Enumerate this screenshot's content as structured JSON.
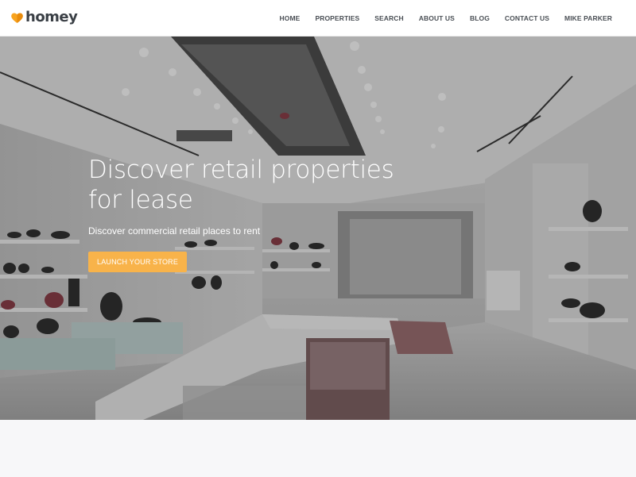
{
  "brand": {
    "name": "homey",
    "accent_color": "#f8a31e"
  },
  "nav": {
    "items": [
      {
        "label": "HOME"
      },
      {
        "label": "PROPERTIES"
      },
      {
        "label": "SEARCH"
      },
      {
        "label": "ABOUT US"
      },
      {
        "label": "BLOG"
      },
      {
        "label": "CONTACT US"
      },
      {
        "label": "MIKE PARKER"
      }
    ]
  },
  "hero": {
    "title_line1": "Discover retail properties",
    "title_line2": "for lease",
    "subtitle": "Discover commercial retail places to rent",
    "cta_label": "LAUNCH YOUR STORE",
    "cta_color": "#f8b34a",
    "background_image": "retail shoe store interior"
  }
}
